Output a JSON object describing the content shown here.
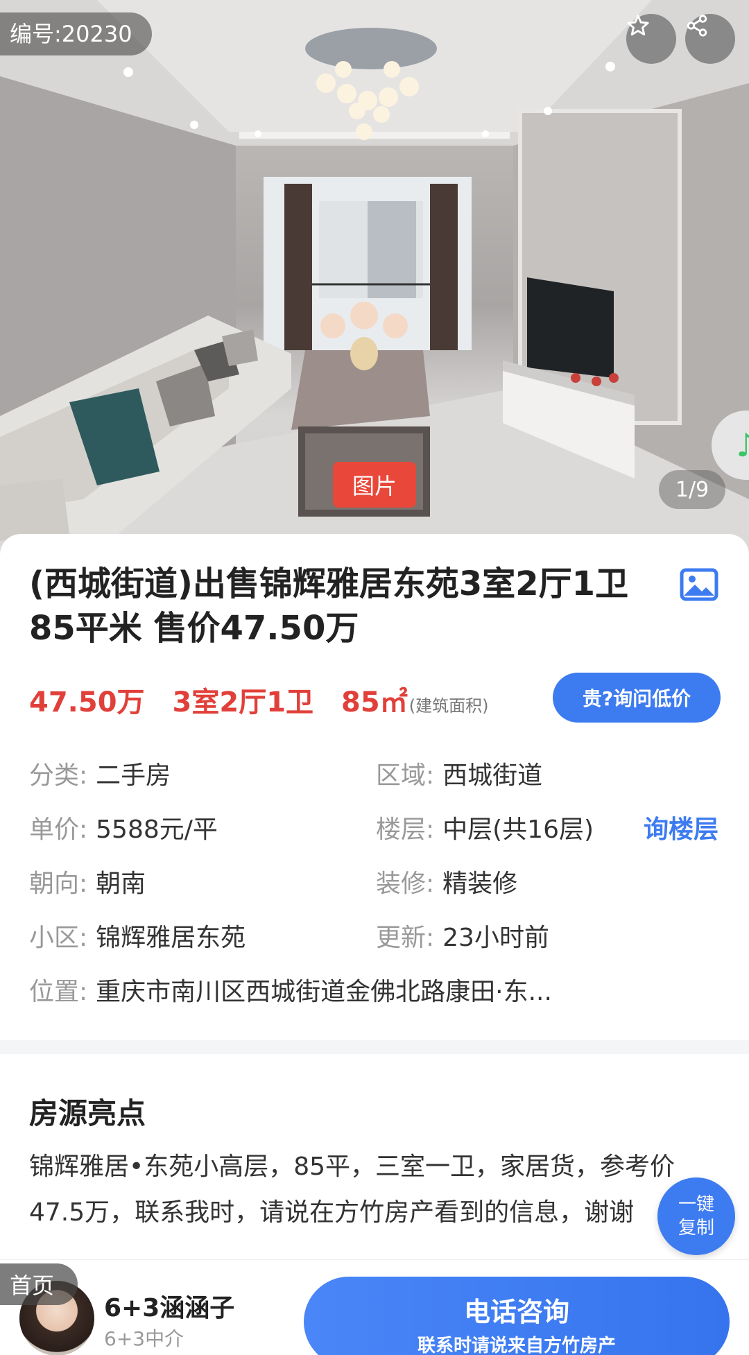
{
  "hero": {
    "listing_id": "编号:20230",
    "photo_tab_label": "图片",
    "photo_counter": "1/9",
    "favorite_icon": "star-outline-icon",
    "share_icon": "share-icon",
    "music_icon": "music-note-icon"
  },
  "listing": {
    "title": "(西城街道)出售锦辉雅居东苑3室2厅1卫85平米 售价47.50万",
    "price": "47.50万",
    "layout": "3室2厅1卫",
    "area": "85㎡",
    "area_note": "(建筑面积)",
    "ask_button": "贵?询问低价",
    "info": {
      "category_label": "分类:",
      "category": "二手房",
      "district_label": "区域:",
      "district": "西城街道",
      "unit_price_label": "单价:",
      "unit_price": "5588元/平",
      "floor_label": "楼层:",
      "floor": "中层(共16层)",
      "floor_link": "询楼层",
      "orientation_label": "朝向:",
      "orientation": "朝南",
      "decoration_label": "装修:",
      "decoration": "精装修",
      "community_label": "小区:",
      "community": "锦辉雅居东苑",
      "updated_label": "更新:",
      "updated": "23小时前",
      "location_label": "位置:",
      "location": "重庆市南川区西城街道金佛北路康田·东..."
    }
  },
  "highlights": {
    "title": "房源亮点",
    "body": "锦辉雅居•东苑小高层，85平，三室一卫，家居货，参考价47.5万，联系我时，请说在方竹房产看到的信息，谢谢",
    "copy_line1": "一键",
    "copy_line2": "复制"
  },
  "bottom": {
    "home_tag": "首页",
    "agent_name": "6+3涵涵子",
    "agent_role": "6+3中介",
    "call_main": "电话咨询",
    "call_sub": "联系时请说来自方竹房产"
  },
  "colors": {
    "accent_blue": "#3d7bf0",
    "price_red": "#e1403a",
    "photo_tab_red": "#e9473a"
  }
}
